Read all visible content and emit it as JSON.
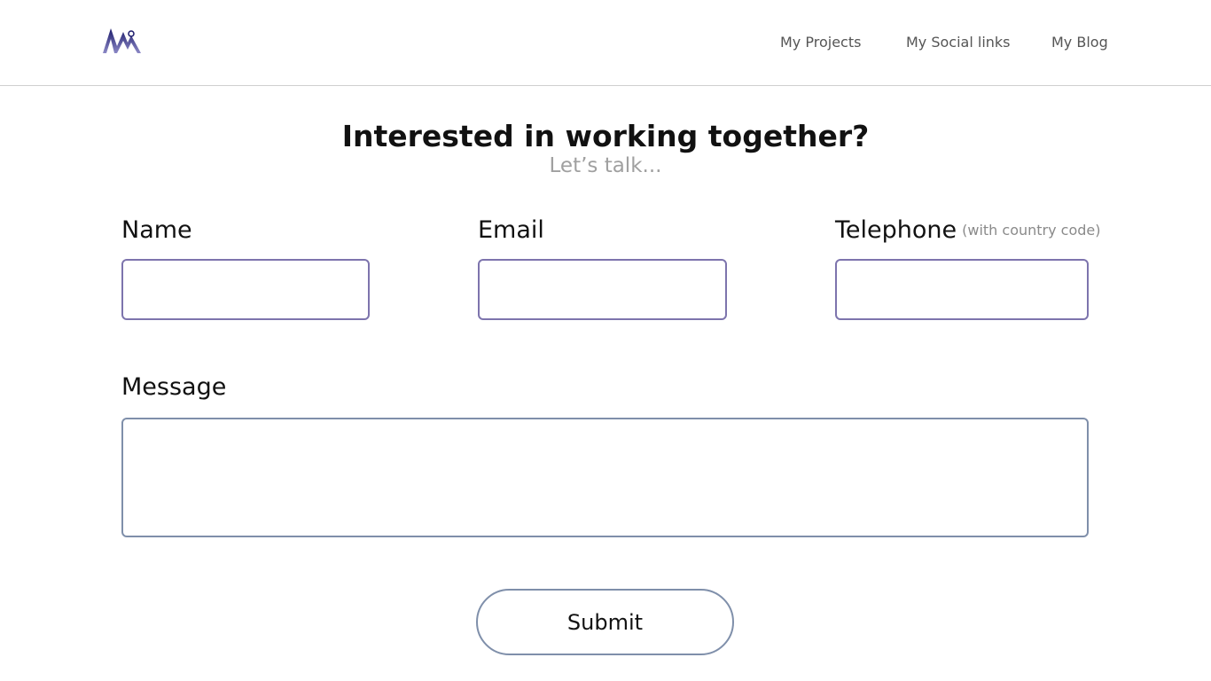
{
  "header": {
    "logo_name": "logo-mountain-icon",
    "nav": [
      {
        "label": "My Projects"
      },
      {
        "label": "My Social links"
      },
      {
        "label": "My Blog"
      }
    ]
  },
  "hero": {
    "title": "Interested in working together?",
    "subtitle": "Let’s talk..."
  },
  "form": {
    "name_label": "Name",
    "email_label": "Email",
    "telephone_label": "Telephone",
    "telephone_hint": "(with country code)",
    "message_label": "Message",
    "name_value": "",
    "email_value": "",
    "telephone_value": "",
    "message_value": "",
    "submit_label": "Submit"
  },
  "colors": {
    "field_border": "#7d74ad",
    "message_border": "#7f8faa",
    "logo_primary": "#1b1a6b"
  }
}
